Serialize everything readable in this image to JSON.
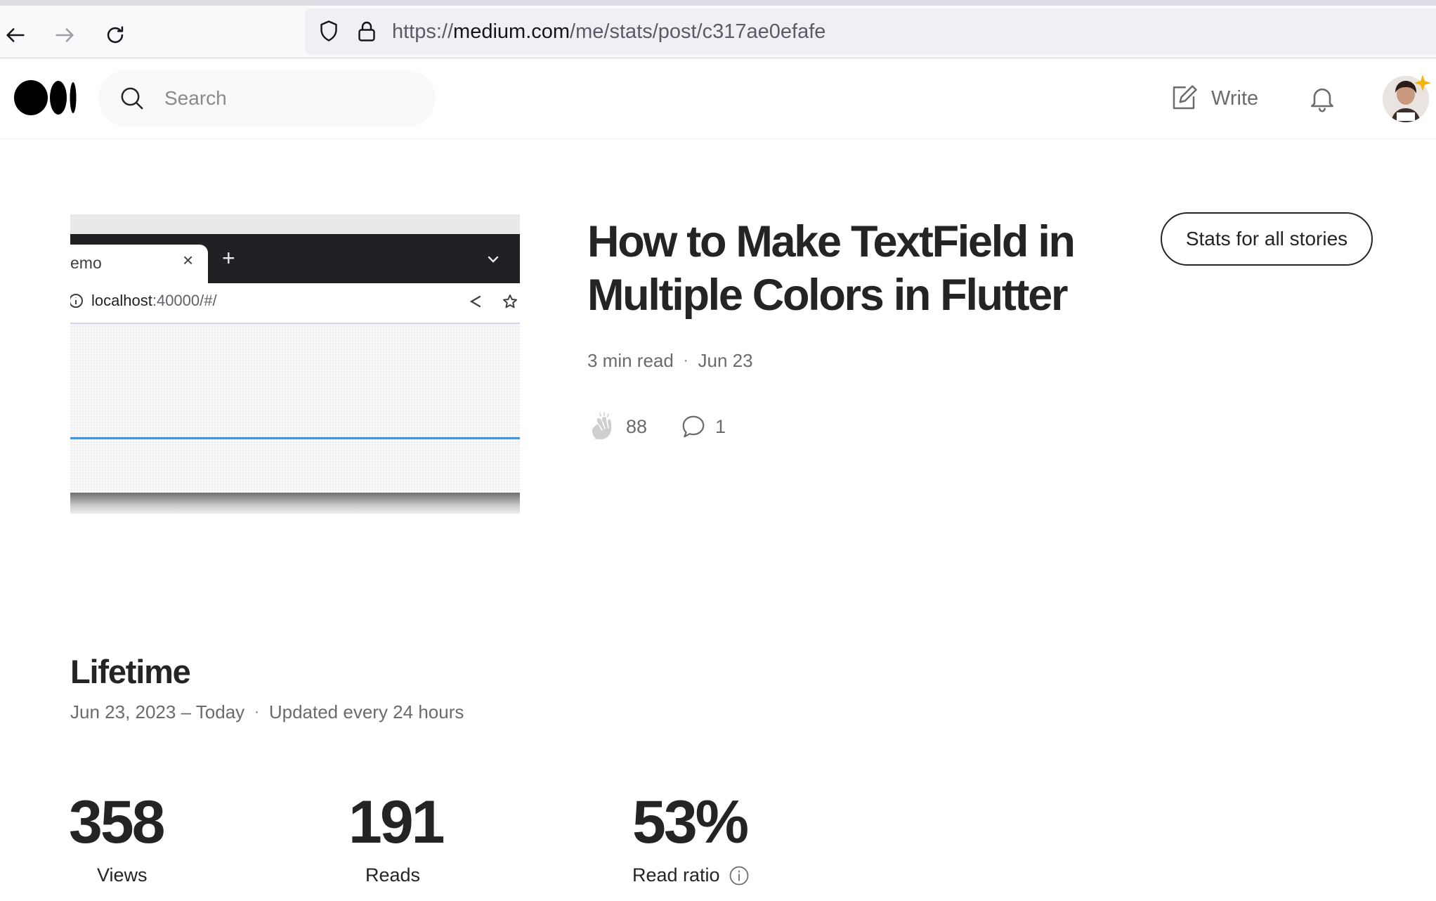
{
  "browser": {
    "url_prefix": "https://",
    "url_host": "medium.com",
    "url_path": "/me/stats/post/c317ae0efafe"
  },
  "header": {
    "search_placeholder": "Search",
    "write_label": "Write"
  },
  "story": {
    "title": "How to Make TextField in Multiple Colors in Flutter",
    "read_time": "3 min read",
    "separator": "·",
    "date": "Jun 23",
    "claps": "88",
    "responses": "1",
    "stats_button_label": "Stats for all stories",
    "thumbnail": {
      "tab_label": "emo",
      "tab_close": "×",
      "new_tab": "+",
      "address_host": "localhost",
      "address_rest": ":40000/#/"
    }
  },
  "lifetime": {
    "heading": "Lifetime",
    "range": "Jun 23, 2023 – Today",
    "separator": "·",
    "update_note": "Updated every 24 hours",
    "stats": [
      {
        "value": "358",
        "label": "Views"
      },
      {
        "value": "191",
        "label": "Reads"
      },
      {
        "value": "53%",
        "label": "Read ratio"
      }
    ]
  },
  "colors": {
    "text": "#242424",
    "muted": "#6b6b6b",
    "accent_line": "#4b8fd9"
  },
  "icons": [
    "back-arrow-icon",
    "forward-arrow-icon",
    "reload-icon",
    "shield-icon",
    "lock-icon",
    "medium-logo",
    "search-icon",
    "write-icon",
    "bell-icon",
    "clap-icon",
    "response-icon",
    "info-icon"
  ]
}
